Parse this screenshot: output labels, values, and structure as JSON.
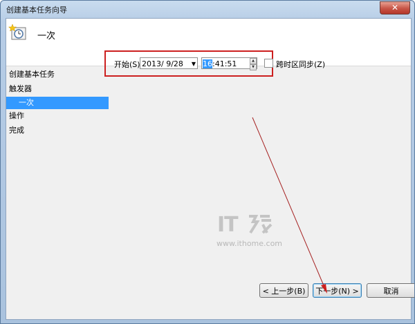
{
  "window": {
    "title": "创建基本任务向导",
    "close_glyph": "✕"
  },
  "header": {
    "title": "一次"
  },
  "sidebar": {
    "items": [
      {
        "label": "创建基本任务"
      },
      {
        "label": "触发器"
      },
      {
        "label": "一次",
        "selected": true
      },
      {
        "label": "操作"
      },
      {
        "label": "完成"
      }
    ]
  },
  "trigger": {
    "start_label": "开始(S):",
    "date_value": "2013/  9/28",
    "time_hour": "16",
    "time_rest": ":41:51",
    "sync_label": "跨时区同步(Z)",
    "sync_checked": false
  },
  "watermark": {
    "logo": "IT",
    "url": "www.ithome.com"
  },
  "buttons": {
    "back": "< 上一步(B)",
    "next": "下一步(N) >",
    "cancel": "取消"
  },
  "colors": {
    "selection": "#3399ff",
    "annotation": "#cc1f1f",
    "arrow": "#a52020"
  }
}
